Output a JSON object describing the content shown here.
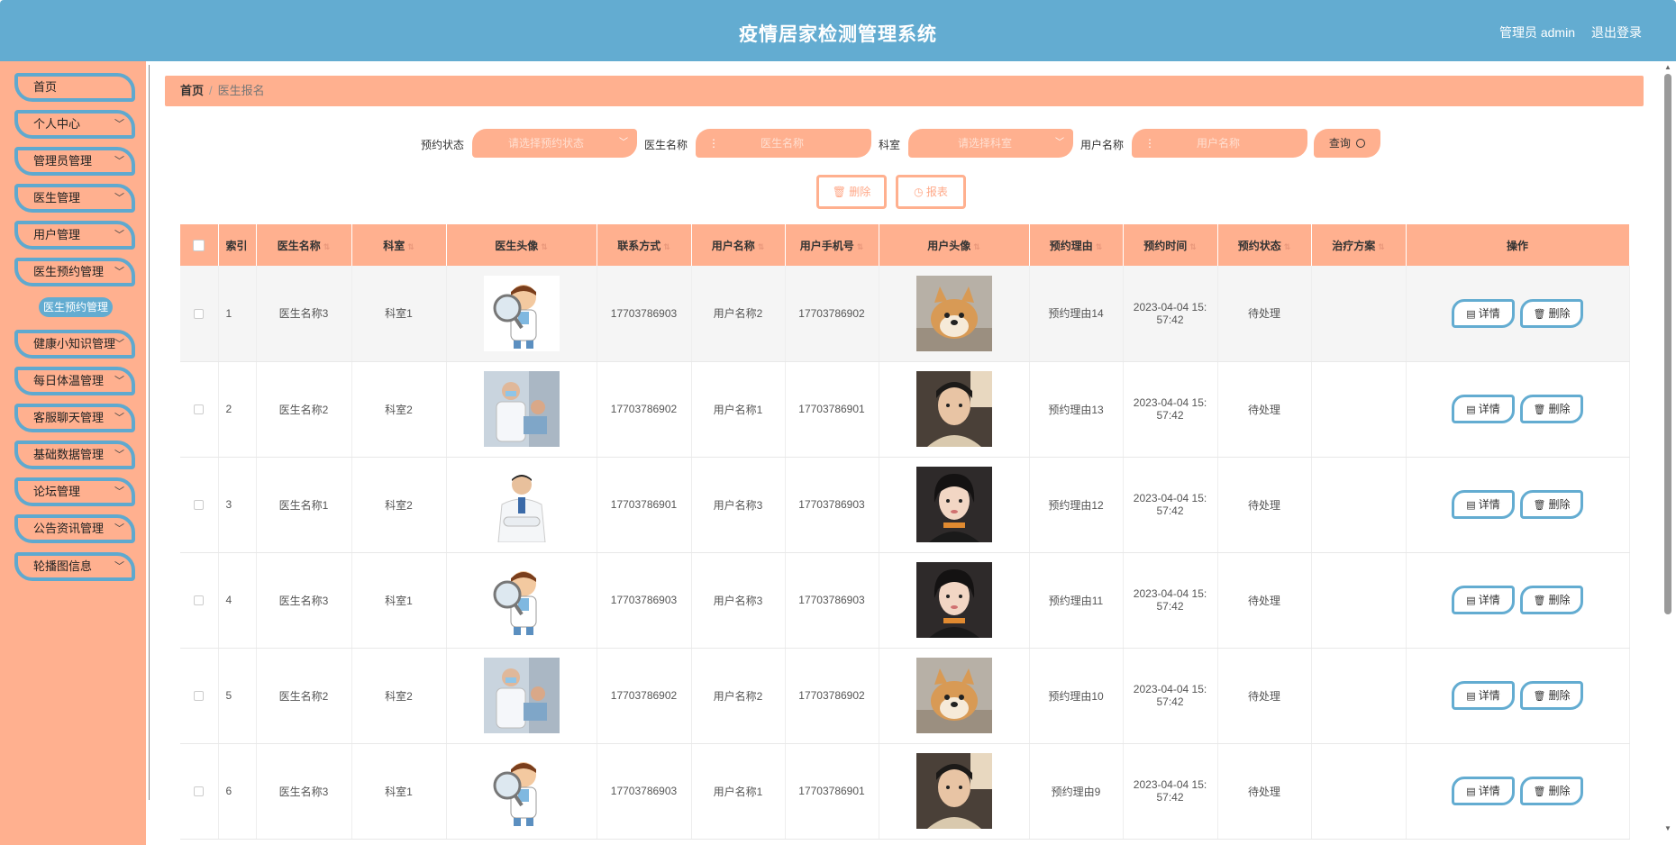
{
  "header": {
    "title": "疫情居家检测管理系统",
    "user": "管理员 admin",
    "logout": "退出登录"
  },
  "sidebar": {
    "items": [
      {
        "label": "首页",
        "has_arrow": false
      },
      {
        "label": "个人中心",
        "has_arrow": true
      },
      {
        "label": "管理员管理",
        "has_arrow": true
      },
      {
        "label": "医生管理",
        "has_arrow": true
      },
      {
        "label": "用户管理",
        "has_arrow": true
      },
      {
        "label": "医生预约管理",
        "has_arrow": true
      },
      {
        "label": "健康小知识管理",
        "has_arrow": true
      },
      {
        "label": "每日体温管理",
        "has_arrow": true
      },
      {
        "label": "客服聊天管理",
        "has_arrow": true
      },
      {
        "label": "基础数据管理",
        "has_arrow": true
      },
      {
        "label": "论坛管理",
        "has_arrow": true
      },
      {
        "label": "公告资讯管理",
        "has_arrow": true
      },
      {
        "label": "轮播图信息",
        "has_arrow": true
      }
    ],
    "active_sub": "医生预约管理"
  },
  "breadcrumb": {
    "home": "首页",
    "current": "医生报名"
  },
  "filters": {
    "status_label": "预约状态",
    "status_placeholder": "请选择预约状态",
    "doctor_label": "医生名称",
    "doctor_placeholder": "医生名称",
    "dept_label": "科室",
    "dept_placeholder": "请选择科室",
    "user_label": "用户名称",
    "user_placeholder": "用户名称",
    "query": "查询"
  },
  "actions": {
    "delete": "删除",
    "report": "报表"
  },
  "table": {
    "headers": [
      "索引",
      "医生名称",
      "科室",
      "医生头像",
      "联系方式",
      "用户名称",
      "用户手机号",
      "用户头像",
      "预约理由",
      "预约时间",
      "预约状态",
      "治疗方案",
      "操作"
    ],
    "detail_label": "详情",
    "delete_label": "删除",
    "rows": [
      {
        "index": "1",
        "doctor": "医生名称3",
        "dept": "科室1",
        "doctor_img": "cartoon-doctor",
        "phone": "17703786903",
        "user": "用户名称2",
        "user_phone": "17703786902",
        "user_img": "shiba-dog",
        "reason": "预约理由14",
        "time_a": "2023-04-04 15:",
        "time_b": "57:42",
        "status": "待处理",
        "plan": ""
      },
      {
        "index": "2",
        "doctor": "医生名称2",
        "dept": "科室2",
        "doctor_img": "doctor-photo",
        "phone": "17703786902",
        "user": "用户名称1",
        "user_phone": "17703786901",
        "user_img": "young-man",
        "reason": "预约理由13",
        "time_a": "2023-04-04 15:",
        "time_b": "57:42",
        "status": "待处理",
        "plan": ""
      },
      {
        "index": "3",
        "doctor": "医生名称1",
        "dept": "科室2",
        "doctor_img": "doctor-arms-crossed",
        "phone": "17703786901",
        "user": "用户名称3",
        "user_phone": "17703786903",
        "user_img": "young-woman",
        "reason": "预约理由12",
        "time_a": "2023-04-04 15:",
        "time_b": "57:42",
        "status": "待处理",
        "plan": ""
      },
      {
        "index": "4",
        "doctor": "医生名称3",
        "dept": "科室1",
        "doctor_img": "cartoon-doctor",
        "phone": "17703786903",
        "user": "用户名称3",
        "user_phone": "17703786903",
        "user_img": "young-woman",
        "reason": "预约理由11",
        "time_a": "2023-04-04 15:",
        "time_b": "57:42",
        "status": "待处理",
        "plan": ""
      },
      {
        "index": "5",
        "doctor": "医生名称2",
        "dept": "科室2",
        "doctor_img": "doctor-photo",
        "phone": "17703786902",
        "user": "用户名称2",
        "user_phone": "17703786902",
        "user_img": "shiba-dog",
        "reason": "预约理由10",
        "time_a": "2023-04-04 15:",
        "time_b": "57:42",
        "status": "待处理",
        "plan": ""
      },
      {
        "index": "6",
        "doctor": "医生名称3",
        "dept": "科室1",
        "doctor_img": "cartoon-doctor",
        "phone": "17703786903",
        "user": "用户名称1",
        "user_phone": "17703786901",
        "user_img": "young-man",
        "reason": "预约理由9",
        "time_a": "2023-04-04 15:",
        "time_b": "57:42",
        "status": "待处理",
        "plan": ""
      }
    ]
  },
  "colors": {
    "header": "#63acd1",
    "accent": "#ffb08f",
    "border_blue": "#5fa9cf"
  }
}
